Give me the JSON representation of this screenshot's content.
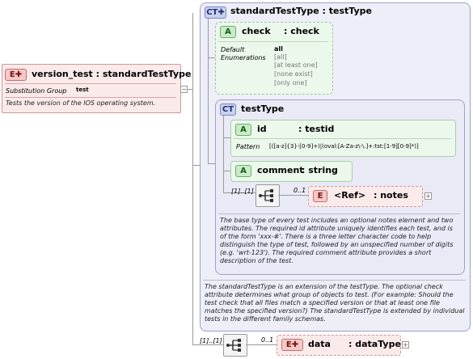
{
  "outer_ct": {
    "badge": "CT",
    "title": "standardTestType : testType",
    "description": "The standardTestType is an extension of the testType.  The optional check attribute determines what group of objects to test.  (For example: Should the test check that all files match a specified version or that at least one file matches the specified version?)  The standardTestType is extended by individual tests in the different family schemas."
  },
  "check_attr": {
    "badge": "A",
    "name": "check",
    "type": ": check",
    "default_label": "Default",
    "default_value": "all",
    "enum_label": "Enumerations",
    "enumerations": [
      "[all]",
      "[at least one]",
      "[none exist]",
      "[only one]"
    ]
  },
  "inner_ct": {
    "badge": "CT",
    "title": "testType",
    "description": "The base type of every test includes an optional notes element and two attributes.  The required id attribute uniquely identifies each test, and is of the form 'xxx-#'.  There is a three letter character code to help distinguish the type of test, followed by an unspecified number of digits (e.g. 'wrt-123').  The required comment attribute provides a short description of the test."
  },
  "id_attr": {
    "badge": "A",
    "name": "id",
    "type": ": testid",
    "pattern_label": "Pattern",
    "pattern_value": "[([a-z]{3}-[0-9]+)|(oval:[A-Za-z\\-\\.]+:tst:[1-9][0-9]*)]"
  },
  "comment_attr": {
    "badge": "A",
    "name": "comment",
    "type": ": string"
  },
  "inner_seq": {
    "cardinality": "[1]..[1]"
  },
  "notes_elem": {
    "badge": "E",
    "name": "<Ref>",
    "type": ": notes",
    "cardinality": "0..1"
  },
  "root_elem": {
    "badge": "E",
    "title": "version_test : standardTestType",
    "subst_label": "Substitution Group",
    "subst_value": "test",
    "description": "Tests the version of the IOS operating system."
  },
  "outer_seq": {
    "cardinality": "[1]..[1]"
  },
  "data_elem": {
    "badge": "E",
    "name": "data",
    "type": ": dataType",
    "cardinality": "0..1"
  },
  "colors": {
    "ct_fill": "#eeeef8",
    "ct_border": "#a0a0c8",
    "attr_fill": "#ecf8ec",
    "elem_fill": "#fbeaea",
    "elem_border": "#cc9a9a"
  },
  "icons": [
    "plus-expand-icon",
    "sequence-compositor-icon"
  ]
}
